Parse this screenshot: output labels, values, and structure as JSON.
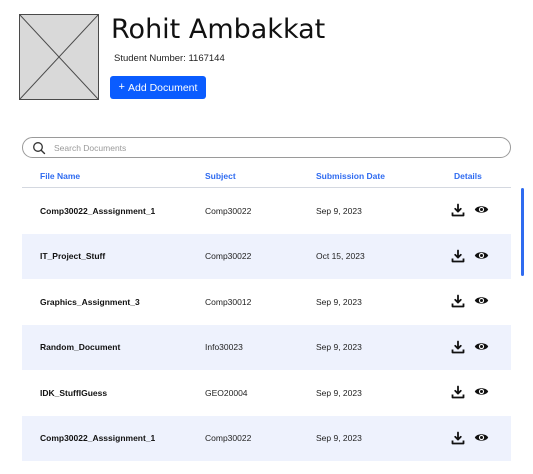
{
  "profile": {
    "name": "Rohit Ambakkat",
    "student_number": "Student Number: 1167144",
    "add_button_icon": "+",
    "add_button_label": "Add Document"
  },
  "search": {
    "placeholder": "Search Documents",
    "value": ""
  },
  "table": {
    "headers": [
      "File Name",
      "Subject",
      "Submission Date",
      "Details"
    ],
    "rows": [
      {
        "file_name": "Comp30022_Asssignment_1",
        "subject": "Comp30022",
        "date": "Sep 9, 2023"
      },
      {
        "file_name": "IT_Project_Stuff",
        "subject": "Comp30022",
        "date": "Oct 15, 2023"
      },
      {
        "file_name": "Graphics_Assignment_3",
        "subject": "Comp30012",
        "date": "Sep 9, 2023"
      },
      {
        "file_name": "Random_Document",
        "subject": "Info30023",
        "date": "Sep 9, 2023"
      },
      {
        "file_name": "IDK_StuffIGuess",
        "subject": "GEO20004",
        "date": "Sep 9, 2023"
      },
      {
        "file_name": "Comp30022_Asssignment_1",
        "subject": "Comp30022",
        "date": "Sep 9, 2023"
      }
    ],
    "row_icons": [
      "download-icon",
      "eye-icon"
    ]
  },
  "colors": {
    "accent": "#0a5cff",
    "header_text": "#2f6bf0",
    "row_alt": "#eef2fd"
  }
}
